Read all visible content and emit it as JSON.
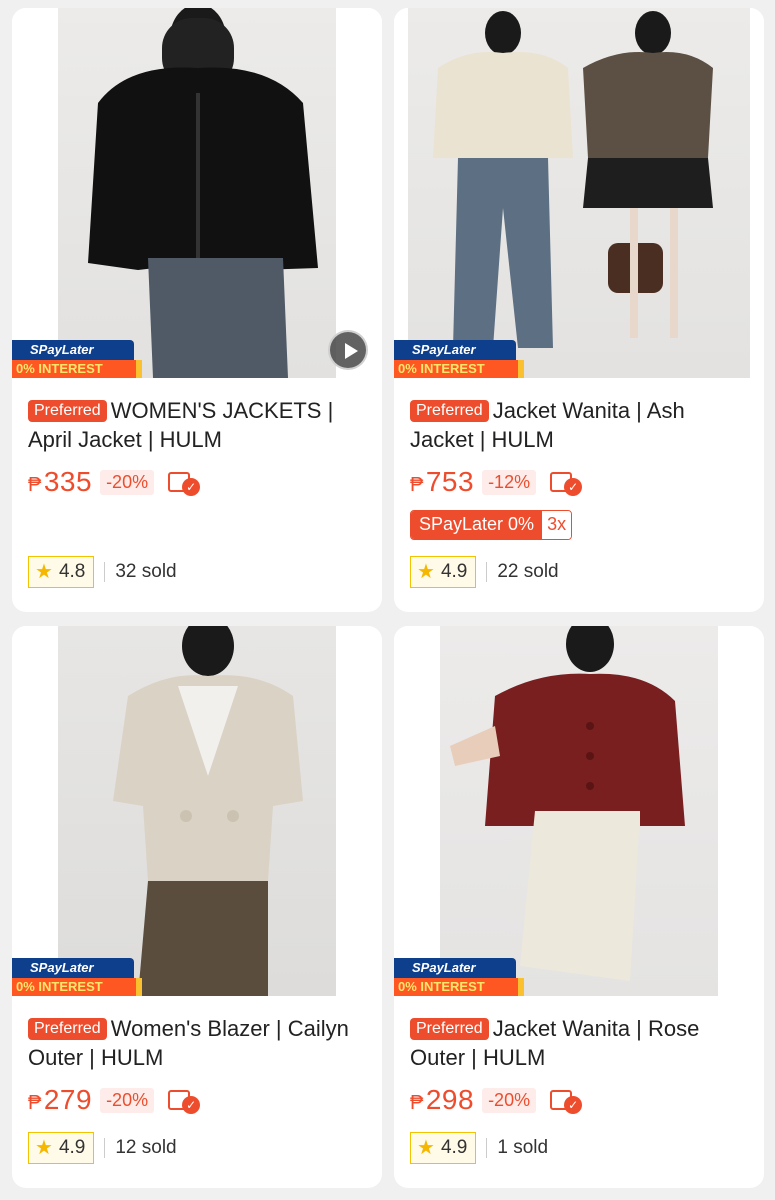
{
  "badges": {
    "spaylater": "SPayLater",
    "interest": "0% INTEREST",
    "preferred": "Preferred",
    "currency": "₱"
  },
  "products": [
    {
      "title": "WOMEN'S JACKETS | April Jacket | HULM",
      "price": "335",
      "discount": "-20%",
      "rating": "4.8",
      "sold": "32 sold",
      "has_video": true
    },
    {
      "title": "Jacket Wanita | Ash Jacket | HULM",
      "price": "753",
      "discount": "-12%",
      "paylater_label": "SPayLater 0%",
      "paylater_term": "3x",
      "rating": "4.9",
      "sold": "22 sold"
    },
    {
      "title": "Women's Blazer | Cailyn Outer | HULM",
      "price": "279",
      "discount": "-20%",
      "rating": "4.9",
      "sold": "12 sold"
    },
    {
      "title": "Jacket Wanita | Rose Outer | HULM",
      "price": "298",
      "discount": "-20%",
      "rating": "4.9",
      "sold": "1 sold"
    }
  ],
  "icons": {
    "play": "play-icon",
    "star": "star-icon",
    "voucher": "voucher-icon"
  },
  "colors": {
    "accent": "#ee4d2d",
    "star": "#f5b700",
    "spay_blue": "#0e3f8c"
  }
}
